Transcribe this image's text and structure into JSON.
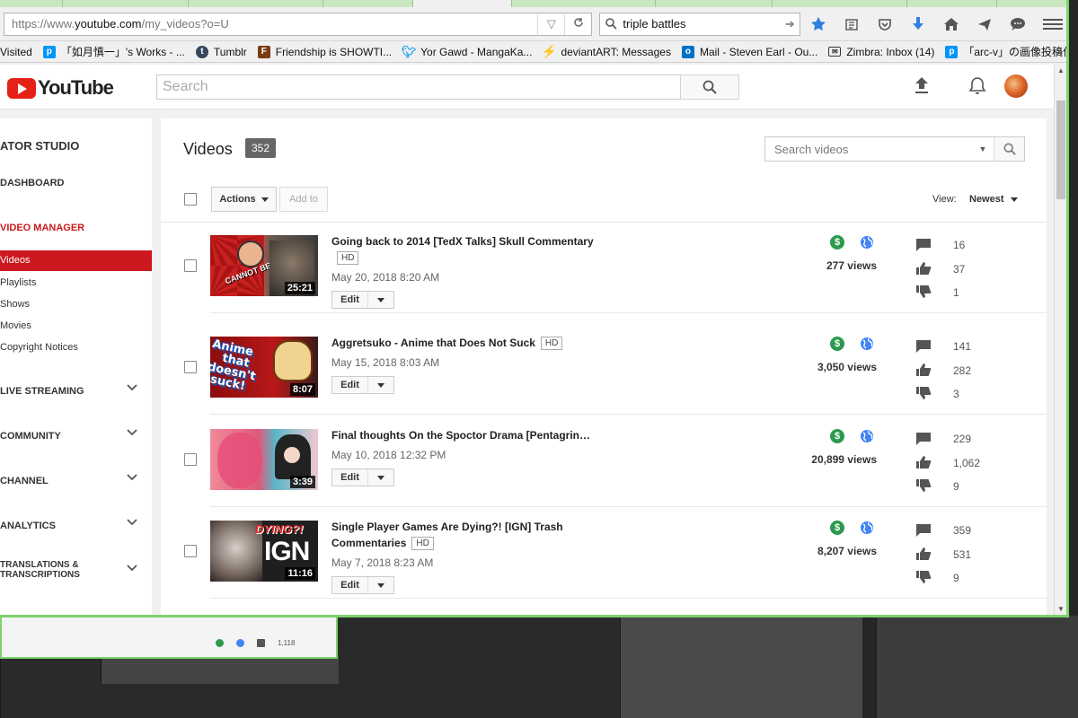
{
  "browser": {
    "url_prefix": "https://www.",
    "url_domain": "youtube.com",
    "url_path": "/my_videos?o=U",
    "search_value": "triple battles",
    "bookmarks": [
      {
        "label": "Visited",
        "icon": "none"
      },
      {
        "label": "「如月慎一」's Works - ...",
        "icon": "pixiv-icon"
      },
      {
        "label": "Tumblr",
        "icon": "tumblr-icon"
      },
      {
        "label": "Friendship is SHOWTI...",
        "icon": "f-icon"
      },
      {
        "label": "Yor Gawd - MangaKa...",
        "icon": "twitter-icon"
      },
      {
        "label": "deviantART: Messages",
        "icon": "deviantart-icon"
      },
      {
        "label": "Mail - Steven Earl - Ou...",
        "icon": "outlook-icon"
      },
      {
        "label": "Zimbra: Inbox (14)",
        "icon": "envelope-icon"
      },
      {
        "label": "「arc-v」の画像投稿作...",
        "icon": "pixiv-icon"
      }
    ],
    "bookmark_overflow": "»"
  },
  "yt": {
    "logo_text": "YouTube",
    "search_placeholder": "Search"
  },
  "sidebar": {
    "title": "ATOR STUDIO",
    "dashboard": "DASHBOARD",
    "video_manager": "VIDEO MANAGER",
    "sub_items": [
      "Videos",
      "Playlists",
      "Shows",
      "Movies",
      "Copyright Notices"
    ],
    "sections": [
      "LIVE STREAMING",
      "COMMUNITY",
      "CHANNEL",
      "ANALYTICS"
    ],
    "translations_line1": "TRANSLATIONS &",
    "translations_line2": "TRANSCRIPTIONS"
  },
  "main": {
    "title": "Videos",
    "count": "352",
    "search_placeholder": "Search videos",
    "actions_label": "Actions",
    "addto_label": "Add to",
    "view_label": "View:",
    "view_value": "Newest"
  },
  "videos": [
    {
      "title": "Going back to 2014 [TedX Talks] Skull Commentary",
      "hd": "HD",
      "date": "May 20, 2018 8:20 AM",
      "duration": "25:21",
      "edit": "Edit",
      "views": "277 views",
      "comments": "16",
      "likes": "37",
      "dislikes": "1"
    },
    {
      "title": "Aggretsuko - Anime that Does Not Suck",
      "hd": "HD",
      "date": "May 15, 2018 8:03 AM",
      "duration": "8:07",
      "edit": "Edit",
      "views": "3,050 views",
      "comments": "141",
      "likes": "282",
      "dislikes": "3"
    },
    {
      "title": "Final thoughts On the Spoctor Drama [Pentagrin…",
      "hd": "",
      "date": "May 10, 2018 12:32 PM",
      "duration": "3:39",
      "edit": "Edit",
      "views": "20,899 views",
      "comments": "229",
      "likes": "1,062",
      "dislikes": "9"
    },
    {
      "title": "Single Player Games Are Dying?! [IGN] Trash Commentaries",
      "hd": "HD",
      "date": "May 7, 2018 8:23 AM",
      "duration": "11:16",
      "edit": "Edit",
      "views": "8,207 views",
      "comments": "359",
      "likes": "531",
      "dislikes": "9"
    }
  ],
  "thumb_text": {
    "v1": "CANNOT BE SEXIER?!",
    "v2_line1": "Anime",
    "v2_line2": "that",
    "v2_line3": "doesn't",
    "v2_line4": "suck!",
    "v4_top": "DYING?!",
    "v4_logo": "IGN"
  },
  "ghost_window": {
    "count": "1,118"
  }
}
